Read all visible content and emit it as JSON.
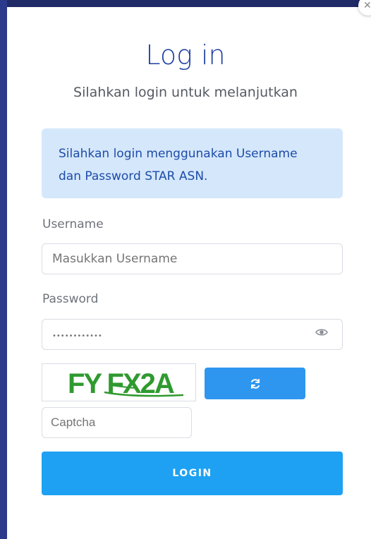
{
  "modal": {
    "close_icon": "close-icon",
    "title": "Log in",
    "subtitle": "Silahkan login untuk melanjutkan"
  },
  "alert": {
    "line1": "Silahkan login menggunakan Username",
    "line2": "dan Password STAR ASN."
  },
  "form": {
    "username_label": "Username",
    "username_placeholder": "Masukkan Username",
    "password_label": "Password",
    "password_masked": "••••••••••••",
    "eye_icon": "eye-icon",
    "captcha_text": "FY FX2A",
    "refresh_icon": "refresh-icon",
    "captcha_placeholder": "Captcha",
    "login_label": "LOGIN"
  },
  "colors": {
    "title": "#1e3fa0",
    "alert_bg": "#d5e7fb",
    "alert_text": "#1d4ca8",
    "refresh_button": "#2f96f0",
    "login_button": "#1ea1f2",
    "captcha_text": "#2f9a2f"
  }
}
